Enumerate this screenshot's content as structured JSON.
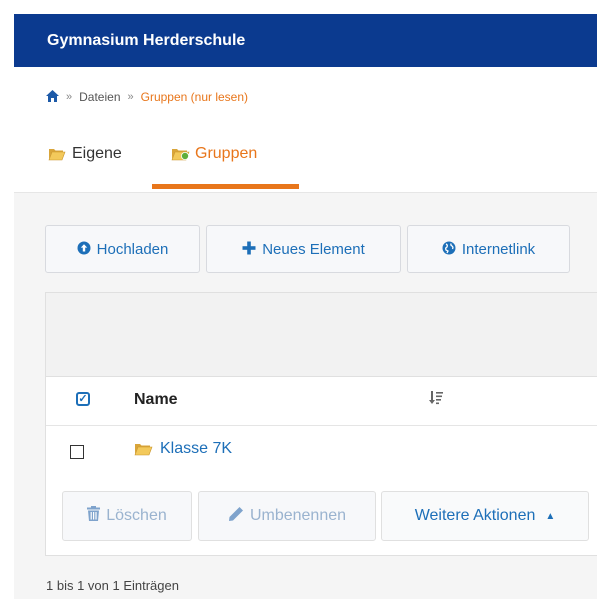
{
  "header": {
    "title": "Gymnasium Herderschule"
  },
  "breadcrumb": {
    "separator": "»",
    "items": [
      "Dateien",
      "Gruppen (nur lesen)"
    ]
  },
  "tabs": [
    {
      "label": "Eigene",
      "active": false
    },
    {
      "label": "Gruppen",
      "active": true
    }
  ],
  "toolbar": {
    "upload_label": "Hochladen",
    "new_label": "Neues Element",
    "link_label": "Internetlink"
  },
  "table": {
    "columns": [
      "Name"
    ],
    "rows": [
      {
        "name": "Klasse 7K",
        "type": "folder"
      }
    ]
  },
  "actions": {
    "delete_label": "Löschen",
    "rename_label": "Umbenennen",
    "more_label": "Weitere Aktionen"
  },
  "footer": {
    "info": "1 bis 1 von 1 Einträgen"
  },
  "colors": {
    "brand": "#0b3a8f",
    "accent": "#e8761b",
    "link": "#1d6fb8"
  }
}
